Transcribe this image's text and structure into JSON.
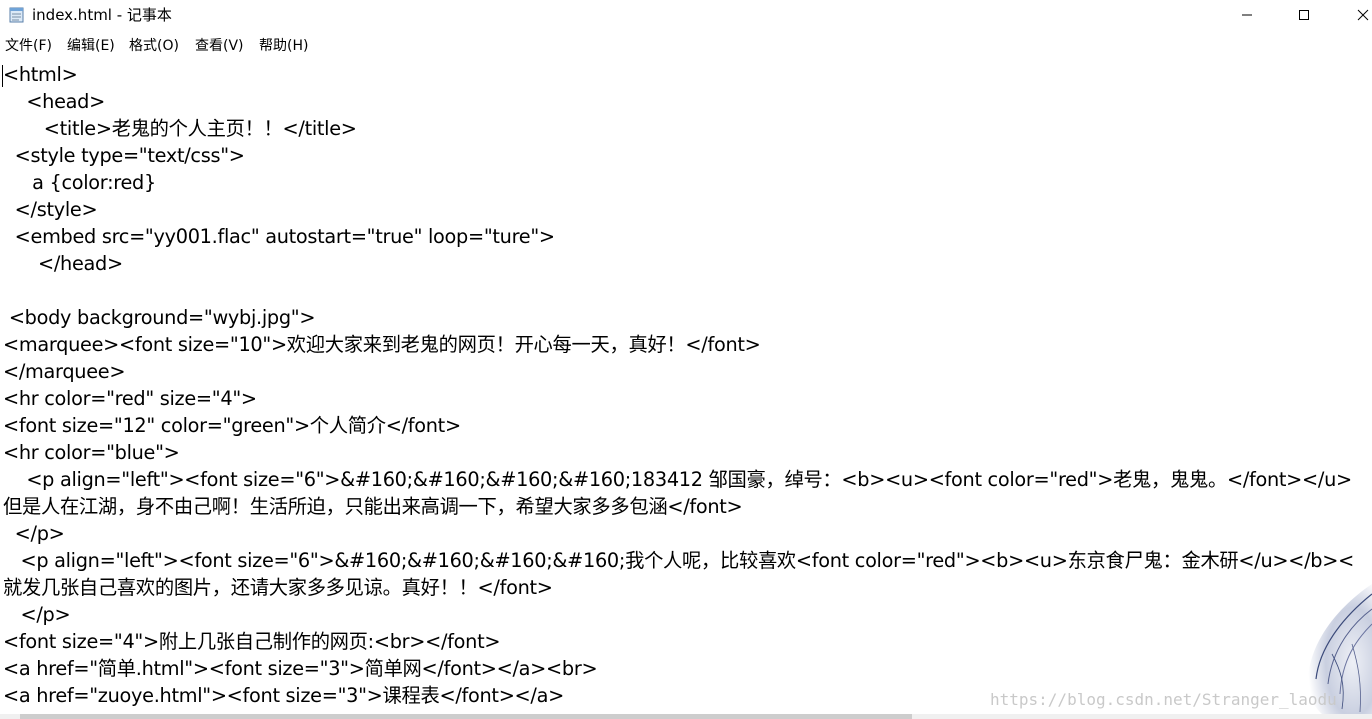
{
  "window": {
    "title": "index.html - 记事本"
  },
  "menu": [
    {
      "label": "文件(F)"
    },
    {
      "label": "编辑(E)"
    },
    {
      "label": "格式(O)"
    },
    {
      "label": "查看(V)"
    },
    {
      "label": "帮助(H)"
    }
  ],
  "editor": {
    "lines": [
      "<html>",
      "    <head>",
      "       <title>老鬼的个人主页！！</title>",
      "  <style type=\"text/css\">",
      "     a {color:red}",
      "  </style>",
      "  <embed src=\"yy001.flac\" autostart=\"true\" loop=\"ture\">",
      "      </head>",
      "",
      " <body background=\"wybj.jpg\">",
      "<marquee><font size=\"10\">欢迎大家来到老鬼的网页！开心每一天，真好！</font>",
      "</marquee>",
      "<hr color=\"red\" size=\"4\">",
      "<font size=\"12\" color=\"green\">个人简介</font>",
      "<hr color=\"blue\">",
      "    <p align=\"left\"><font size=\"6\">&#160;&#160;&#160;&#160;183412 邹国豪，绰号：<b><u><font color=\"red\">老鬼，鬼鬼。</font></u>",
      "但是人在江湖，身不由己啊！生活所迫，只能出来高调一下，希望大家多多包涵</font>",
      "  </p>",
      "   <p align=\"left\"><font size=\"6\">&#160;&#160;&#160;&#160;我个人呢，比较喜欢<font color=\"red\"><b><u>东京食尸鬼：金木研</u></b><",
      "就发几张自己喜欢的图片，还请大家多多见谅。真好！！</font>",
      "   </p>",
      "<font size=\"4\">附上几张自己制作的网页:<br></font>",
      "<a href=\"简单.html\"><font size=\"3\">简单网</font></a><br>",
      "<a href=\"zuoye.html\"><font size=\"3\">课程表</font></a>"
    ]
  },
  "watermark": "https://blog.csdn.net/Stranger_laodu",
  "icons": {
    "app": "notepad-icon",
    "minimize": "minimize-icon",
    "maximize": "maximize-icon",
    "close": "close-icon"
  }
}
